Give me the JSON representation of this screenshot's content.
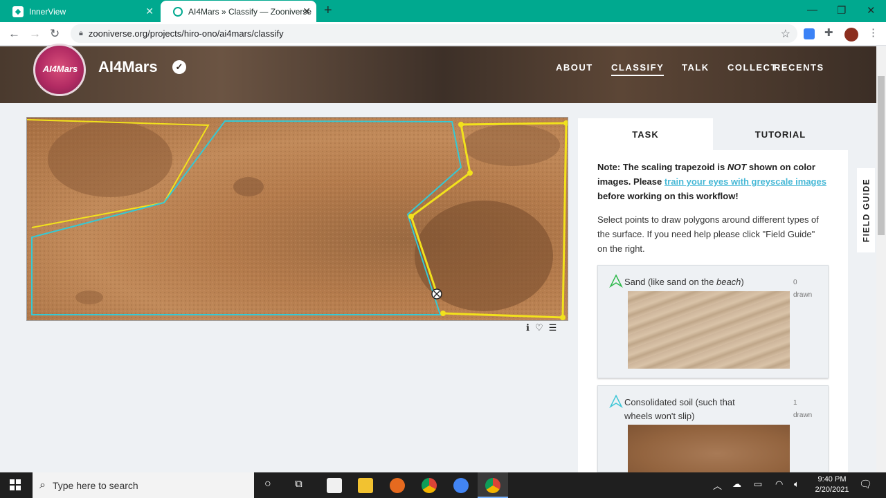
{
  "browser": {
    "tabs": [
      {
        "title": "InnerView"
      },
      {
        "title": "AI4Mars » Classify — Zooniverse"
      }
    ],
    "url": "zooniverse.org/projects/hiro-ono/ai4mars/classify"
  },
  "project": {
    "avatar_text": "AI4Mars",
    "title": "AI4Mars",
    "nav": [
      "ABOUT",
      "CLASSIFY",
      "TALK",
      "COLLECT",
      "RECENTS"
    ],
    "active_nav": "CLASSIFY"
  },
  "task_panel": {
    "tabs": [
      "TASK",
      "TUTORIAL"
    ],
    "note_before": "Note: The scaling trapezoid is ",
    "note_emph": "NOT",
    "note_middle": " shown on color images. Please ",
    "note_link": "train your eyes with greyscale images",
    "note_after": " before working on this workflow!",
    "instructions": "Select points to draw polygons around different types of the surface. If you need help please click \"Field Guide\" on the right.",
    "choices": [
      {
        "label_before": "Sand (like sand on the ",
        "label_emph": "beach",
        "label_after": ")",
        "count": "0",
        "count_suffix": "drawn",
        "color": "#2db84a"
      },
      {
        "label_before": "Consolidated soil (such that wheels won't slip)",
        "label_emph": "",
        "label_after": "",
        "count": "1",
        "count_suffix": "drawn",
        "color": "#3ec6d6"
      }
    ],
    "field_guide": "FIELD GUIDE"
  },
  "annotation_colors": {
    "yellow": "#f2e21c",
    "cyan": "#35c9d4"
  },
  "taskbar": {
    "search_placeholder": "Type here to search",
    "time": "9:40 PM",
    "date": "2/20/2021"
  }
}
